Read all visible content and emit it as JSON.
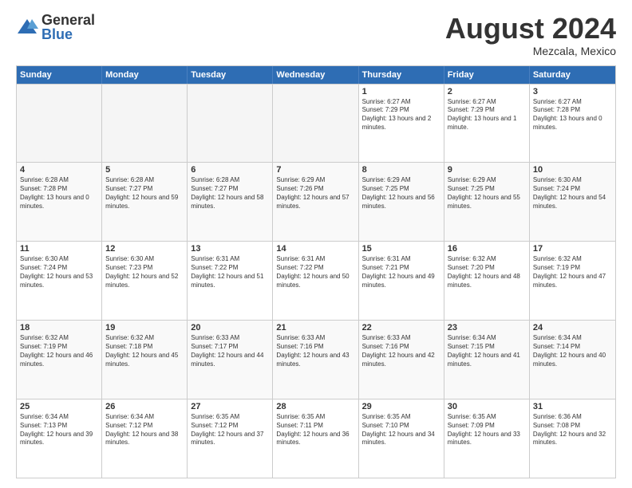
{
  "logo": {
    "general": "General",
    "blue": "Blue"
  },
  "header": {
    "month": "August 2024",
    "location": "Mezcala, Mexico"
  },
  "weekdays": [
    "Sunday",
    "Monday",
    "Tuesday",
    "Wednesday",
    "Thursday",
    "Friday",
    "Saturday"
  ],
  "weeks": [
    [
      {
        "day": "",
        "empty": true
      },
      {
        "day": "",
        "empty": true
      },
      {
        "day": "",
        "empty": true
      },
      {
        "day": "",
        "empty": true
      },
      {
        "day": "1",
        "sunrise": "6:27 AM",
        "sunset": "7:29 PM",
        "daylight": "13 hours and 2 minutes."
      },
      {
        "day": "2",
        "sunrise": "6:27 AM",
        "sunset": "7:29 PM",
        "daylight": "13 hours and 1 minute."
      },
      {
        "day": "3",
        "sunrise": "6:27 AM",
        "sunset": "7:28 PM",
        "daylight": "13 hours and 0 minutes."
      }
    ],
    [
      {
        "day": "4",
        "sunrise": "6:28 AM",
        "sunset": "7:28 PM",
        "daylight": "13 hours and 0 minutes."
      },
      {
        "day": "5",
        "sunrise": "6:28 AM",
        "sunset": "7:27 PM",
        "daylight": "12 hours and 59 minutes."
      },
      {
        "day": "6",
        "sunrise": "6:28 AM",
        "sunset": "7:27 PM",
        "daylight": "12 hours and 58 minutes."
      },
      {
        "day": "7",
        "sunrise": "6:29 AM",
        "sunset": "7:26 PM",
        "daylight": "12 hours and 57 minutes."
      },
      {
        "day": "8",
        "sunrise": "6:29 AM",
        "sunset": "7:25 PM",
        "daylight": "12 hours and 56 minutes."
      },
      {
        "day": "9",
        "sunrise": "6:29 AM",
        "sunset": "7:25 PM",
        "daylight": "12 hours and 55 minutes."
      },
      {
        "day": "10",
        "sunrise": "6:30 AM",
        "sunset": "7:24 PM",
        "daylight": "12 hours and 54 minutes."
      }
    ],
    [
      {
        "day": "11",
        "sunrise": "6:30 AM",
        "sunset": "7:24 PM",
        "daylight": "12 hours and 53 minutes."
      },
      {
        "day": "12",
        "sunrise": "6:30 AM",
        "sunset": "7:23 PM",
        "daylight": "12 hours and 52 minutes."
      },
      {
        "day": "13",
        "sunrise": "6:31 AM",
        "sunset": "7:22 PM",
        "daylight": "12 hours and 51 minutes."
      },
      {
        "day": "14",
        "sunrise": "6:31 AM",
        "sunset": "7:22 PM",
        "daylight": "12 hours and 50 minutes."
      },
      {
        "day": "15",
        "sunrise": "6:31 AM",
        "sunset": "7:21 PM",
        "daylight": "12 hours and 49 minutes."
      },
      {
        "day": "16",
        "sunrise": "6:32 AM",
        "sunset": "7:20 PM",
        "daylight": "12 hours and 48 minutes."
      },
      {
        "day": "17",
        "sunrise": "6:32 AM",
        "sunset": "7:19 PM",
        "daylight": "12 hours and 47 minutes."
      }
    ],
    [
      {
        "day": "18",
        "sunrise": "6:32 AM",
        "sunset": "7:19 PM",
        "daylight": "12 hours and 46 minutes."
      },
      {
        "day": "19",
        "sunrise": "6:32 AM",
        "sunset": "7:18 PM",
        "daylight": "12 hours and 45 minutes."
      },
      {
        "day": "20",
        "sunrise": "6:33 AM",
        "sunset": "7:17 PM",
        "daylight": "12 hours and 44 minutes."
      },
      {
        "day": "21",
        "sunrise": "6:33 AM",
        "sunset": "7:16 PM",
        "daylight": "12 hours and 43 minutes."
      },
      {
        "day": "22",
        "sunrise": "6:33 AM",
        "sunset": "7:16 PM",
        "daylight": "12 hours and 42 minutes."
      },
      {
        "day": "23",
        "sunrise": "6:34 AM",
        "sunset": "7:15 PM",
        "daylight": "12 hours and 41 minutes."
      },
      {
        "day": "24",
        "sunrise": "6:34 AM",
        "sunset": "7:14 PM",
        "daylight": "12 hours and 40 minutes."
      }
    ],
    [
      {
        "day": "25",
        "sunrise": "6:34 AM",
        "sunset": "7:13 PM",
        "daylight": "12 hours and 39 minutes."
      },
      {
        "day": "26",
        "sunrise": "6:34 AM",
        "sunset": "7:12 PM",
        "daylight": "12 hours and 38 minutes."
      },
      {
        "day": "27",
        "sunrise": "6:35 AM",
        "sunset": "7:12 PM",
        "daylight": "12 hours and 37 minutes."
      },
      {
        "day": "28",
        "sunrise": "6:35 AM",
        "sunset": "7:11 PM",
        "daylight": "12 hours and 36 minutes."
      },
      {
        "day": "29",
        "sunrise": "6:35 AM",
        "sunset": "7:10 PM",
        "daylight": "12 hours and 34 minutes."
      },
      {
        "day": "30",
        "sunrise": "6:35 AM",
        "sunset": "7:09 PM",
        "daylight": "12 hours and 33 minutes."
      },
      {
        "day": "31",
        "sunrise": "6:36 AM",
        "sunset": "7:08 PM",
        "daylight": "12 hours and 32 minutes."
      }
    ]
  ]
}
